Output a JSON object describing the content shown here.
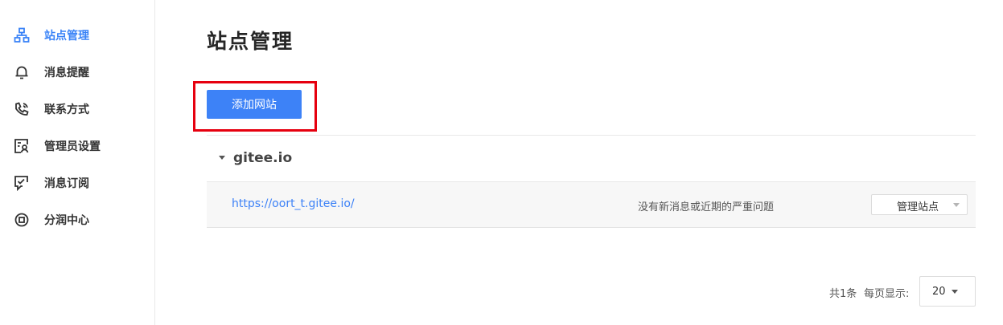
{
  "sidebar": {
    "items": [
      {
        "label": "站点管理",
        "icon": "sitemap-icon",
        "active": true
      },
      {
        "label": "消息提醒",
        "icon": "bell-icon",
        "active": false
      },
      {
        "label": "联系方式",
        "icon": "phone-icon",
        "active": false
      },
      {
        "label": "管理员设置",
        "icon": "admin-user-icon",
        "active": false
      },
      {
        "label": "消息订阅",
        "icon": "subscribe-check-icon",
        "active": false
      },
      {
        "label": "分润中心",
        "icon": "profit-center-icon",
        "active": false
      }
    ]
  },
  "main": {
    "title": "站点管理",
    "add_button_label": "添加网站",
    "groups": [
      {
        "name": "gitee.io",
        "sites": [
          {
            "url": "https://oort_t.gitee.io/",
            "status": "没有新消息或近期的严重问题",
            "action_label": "管理站点"
          }
        ]
      }
    ]
  },
  "pagination": {
    "total": "共1条",
    "page_size_label": "每页显示:",
    "page_size": "20"
  },
  "colors": {
    "accent": "#3d82f7",
    "highlight_box": "#e6000f"
  }
}
